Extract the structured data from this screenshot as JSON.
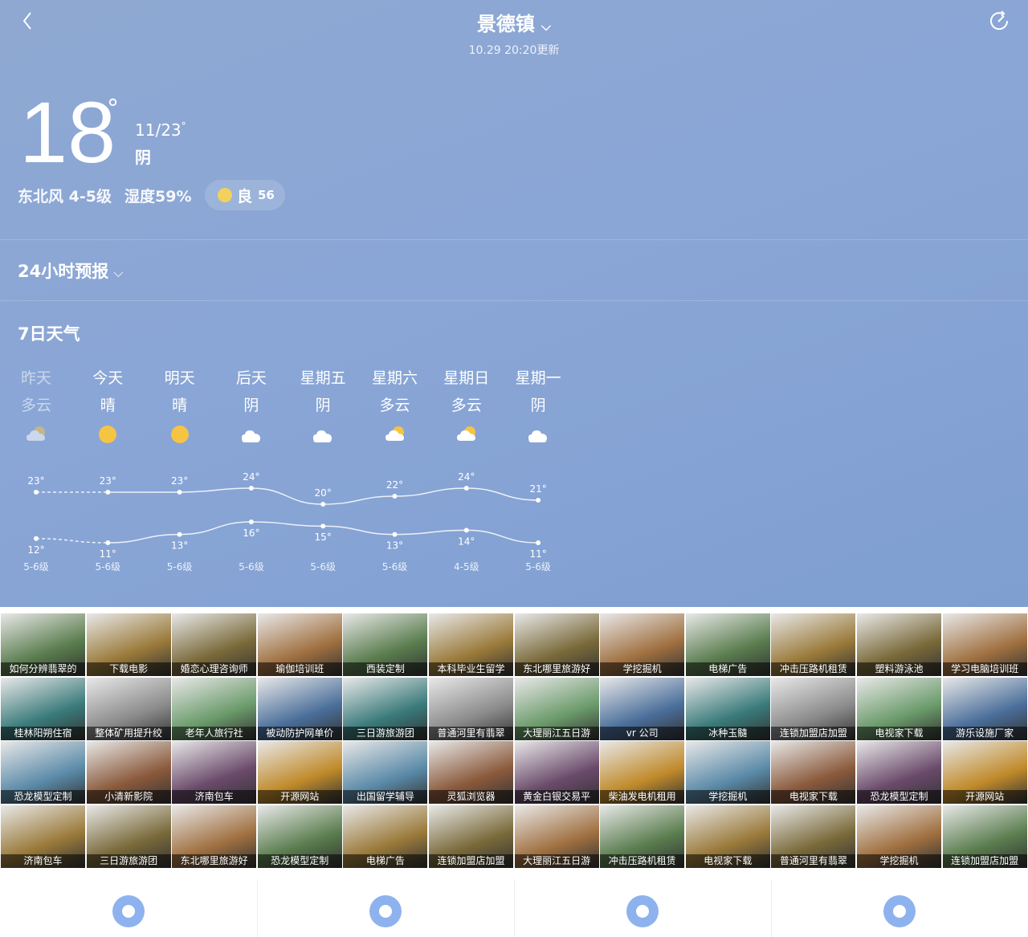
{
  "header": {
    "city": "景德镇",
    "updated": "10.29 20:20更新"
  },
  "current": {
    "temp": "18",
    "deg": "°",
    "range": "11/23",
    "range_deg": "°",
    "condition": "阴",
    "wind": "东北风 4-5级",
    "humidity": "湿度59%",
    "aqi_level": "良",
    "aqi_value": "56"
  },
  "forecast24": {
    "label": "24小时预报"
  },
  "week": {
    "label": "7日天气",
    "days": [
      {
        "name": "昨天",
        "cond": "多云",
        "icon": "cloudy-sun",
        "wind": "5-6级",
        "high": 23,
        "low": 12,
        "past": true
      },
      {
        "name": "今天",
        "cond": "晴",
        "icon": "sun",
        "wind": "5-6级",
        "high": 23,
        "low": 11
      },
      {
        "name": "明天",
        "cond": "晴",
        "icon": "sun",
        "wind": "5-6级",
        "high": 23,
        "low": 13
      },
      {
        "name": "后天",
        "cond": "阴",
        "icon": "cloud",
        "wind": "5-6级",
        "high": 24,
        "low": 16
      },
      {
        "name": "星期五",
        "cond": "阴",
        "icon": "cloud",
        "wind": "5-6级",
        "high": 20,
        "low": 15
      },
      {
        "name": "星期六",
        "cond": "多云",
        "icon": "cloudy-sun",
        "wind": "5-6级",
        "high": 22,
        "low": 13
      },
      {
        "name": "星期日",
        "cond": "多云",
        "icon": "cloudy-sun",
        "wind": "4-5级",
        "high": 24,
        "low": 14
      },
      {
        "name": "星期一",
        "cond": "阴",
        "icon": "cloud",
        "wind": "5-6级",
        "high": 21,
        "low": 11
      }
    ]
  },
  "chart_data": {
    "type": "line",
    "categories": [
      "昨天",
      "今天",
      "明天",
      "后天",
      "星期五",
      "星期六",
      "星期日",
      "星期一"
    ],
    "series": [
      {
        "values": [
          23,
          23,
          23,
          24,
          20,
          22,
          24,
          21
        ]
      },
      {
        "values": [
          12,
          11,
          13,
          16,
          15,
          13,
          14,
          11
        ]
      }
    ],
    "unit": "°"
  },
  "ads": [
    [
      "如何分辨翡翠的",
      "下载电影",
      "婚恋心理咨询师",
      "瑜伽培训班",
      "西装定制",
      "本科毕业生留学",
      "东北哪里旅游好",
      "学挖掘机",
      "电梯广告",
      "冲击压路机租赁",
      "塑料游泳池",
      "学习电脑培训班"
    ],
    [
      "桂林阳朔住宿",
      "整体矿用提升绞",
      "老年人旅行社",
      "被动防护网单价",
      "三日游旅游团",
      "普通河里有翡翠",
      "大理丽江五日游",
      "vr 公司",
      "冰种玉髓",
      "连锁加盟店加盟",
      "电视家下载",
      "游乐设施厂家"
    ],
    [
      "恐龙模型定制",
      "小清新影院",
      "济南包车",
      "开源网站",
      "出国留学辅导",
      "灵狐浏览器",
      "黄金白银交易平",
      "柴油发电机租用",
      "学挖掘机",
      "电视家下载",
      "恐龙模型定制",
      "开源网站"
    ],
    [
      "济南包车",
      "三日游旅游团",
      "东北哪里旅游好",
      "恐龙模型定制",
      "电梯广告",
      "连锁加盟店加盟",
      "大理丽江五日游",
      "冲击压路机租赁",
      "电视家下载",
      "普通河里有翡翠",
      "学挖掘机",
      "连锁加盟店加盟"
    ]
  ],
  "tabs": [
    {
      "name": "tab-flower",
      "icon": "flower-icon"
    },
    {
      "name": "tab-calendar",
      "icon": "calendar-icon"
    },
    {
      "name": "tab-clothing",
      "icon": "shirt-icon"
    },
    {
      "name": "tab-sun",
      "icon": "sun-icon"
    }
  ]
}
